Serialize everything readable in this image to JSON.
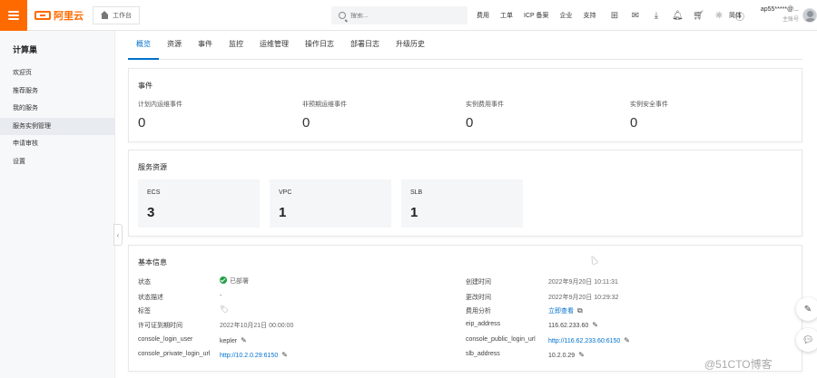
{
  "header": {
    "brand": "阿里云",
    "workbench": "工作台",
    "search_placeholder": "搜索...",
    "nav": [
      "费用",
      "工单",
      "ICP 备案",
      "企业",
      "支持"
    ],
    "lang": "简体",
    "account_name": "ap55*****@...",
    "account_role": "主账号",
    "icons": [
      "cloud-shell-icon",
      "message-icon",
      "download-icon",
      "notification-icon",
      "cart-icon",
      "tips-icon",
      "help-icon"
    ]
  },
  "sidebar": {
    "title": "计算巢",
    "items": [
      {
        "label": "欢迎页"
      },
      {
        "label": "推荐服务"
      },
      {
        "label": "我的服务"
      },
      {
        "label": "服务实例管理"
      },
      {
        "label": "申请审核"
      },
      {
        "label": "设置"
      }
    ]
  },
  "tabs": [
    "概览",
    "资源",
    "事件",
    "监控",
    "运维管理",
    "操作日志",
    "部署日志",
    "升级历史"
  ],
  "events": {
    "title": "事件",
    "items": [
      {
        "label": "计划内运维事件",
        "value": "0"
      },
      {
        "label": "非预期运维事件",
        "value": "0"
      },
      {
        "label": "实例费用事件",
        "value": "0"
      },
      {
        "label": "实例安全事件",
        "value": "0"
      }
    ]
  },
  "resources": {
    "title": "服务资源",
    "items": [
      {
        "label": "ECS",
        "value": "3"
      },
      {
        "label": "VPC",
        "value": "1"
      },
      {
        "label": "SLB",
        "value": "1"
      }
    ]
  },
  "info": {
    "title": "基本信息",
    "left": [
      {
        "label": "状态",
        "value": "已部署"
      },
      {
        "label": "状态描述",
        "value": "-"
      },
      {
        "label": "标签",
        "value": ""
      },
      {
        "label": "许可证到期时间",
        "value": "2022年10月21日 00:00:00"
      },
      {
        "label": "console_login_user",
        "value": "kepler"
      },
      {
        "label": "console_private_login_url",
        "value": "http://10.2.0.29:6150"
      }
    ],
    "right": [
      {
        "label": "创建时间",
        "value": "2022年9月20日 10:11:31"
      },
      {
        "label": "更改时间",
        "value": "2022年9月20日 10:29:32"
      },
      {
        "label": "费用分析",
        "value": "立即查看"
      },
      {
        "label": "eip_address",
        "value": "116.62.233.60"
      },
      {
        "label": "console_public_login_url",
        "value": "http://116.62.233.60:6150"
      },
      {
        "label": "slb_address",
        "value": "10.2.0.29"
      }
    ]
  },
  "watermark": "@51CTO博客",
  "colors": {
    "brand": "#ff6a00",
    "accent": "#0070cc",
    "success": "#23a047"
  }
}
